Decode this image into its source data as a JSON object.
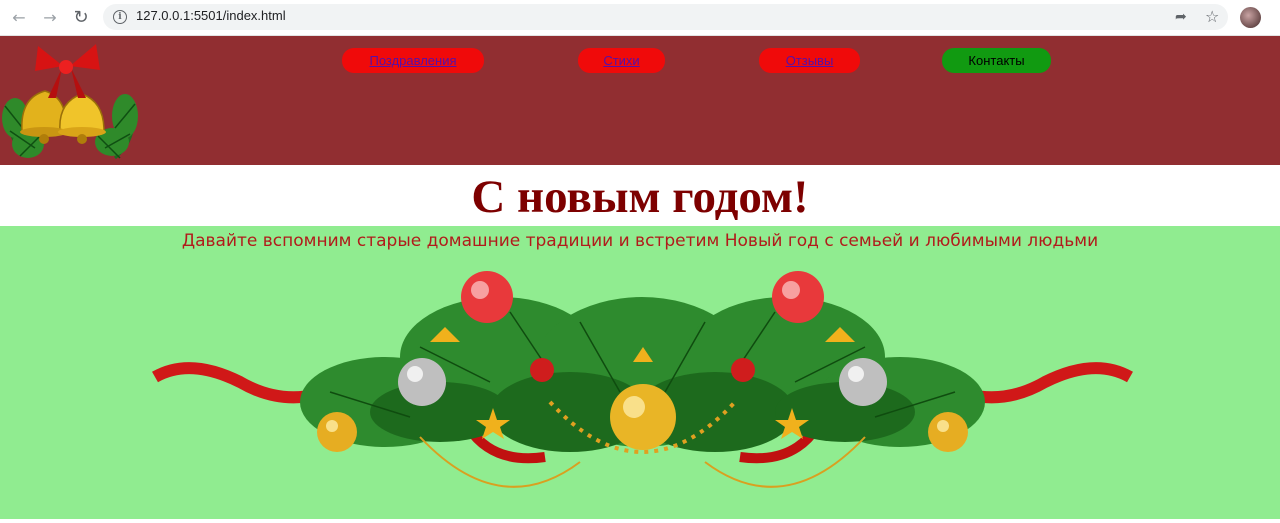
{
  "browser": {
    "url": "127.0.0.1:5501/index.html"
  },
  "menu": {
    "items": [
      {
        "label": "Поздравления"
      },
      {
        "label": "Стихи"
      },
      {
        "label": "Отзывы"
      },
      {
        "label": "Контакты"
      }
    ]
  },
  "hero": {
    "title": "С новым годом!",
    "subtitle": "Давайте вспомним старые домашние традиции и встретим Новый год с семьей и любимыми людьми"
  },
  "colors": {
    "header_bg": "#912e31",
    "menu_red": "#f00a0a",
    "menu_green": "#119a11",
    "title": "#7d0000",
    "content_bg": "#90ec90",
    "subtitle": "#b11b1b"
  }
}
